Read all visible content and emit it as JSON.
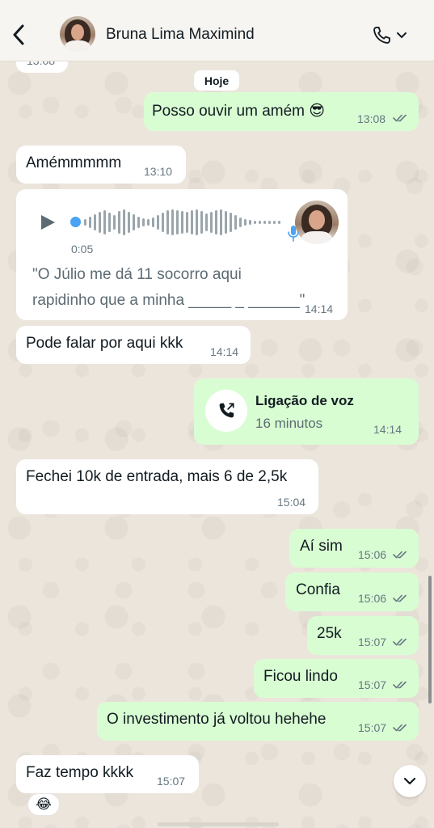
{
  "header": {
    "contact_name": "Bruna Lima Maximind",
    "back_icon": "chevron-left-icon",
    "call_icon": "phone-icon",
    "menu_icon": "chevron-down-icon"
  },
  "partial_top_time": "13:08",
  "day_chip": "Hoje",
  "messages": [
    {
      "dir": "out",
      "text": "Posso ouvir um amém 😎",
      "time": "13:08",
      "read": true
    },
    {
      "dir": "in",
      "text": "Amémmmmm",
      "time": "13:10"
    },
    {
      "dir": "in",
      "type": "voice",
      "duration": "0:05",
      "transcript_line1": "\"O Júlio me dá 11 socorro aqui",
      "transcript_line2": "rapidinho que a minha _____ _ ______\"",
      "time": "14:14"
    },
    {
      "dir": "in",
      "text": "Pode falar por aqui kkk",
      "time": "14:14"
    },
    {
      "dir": "out",
      "type": "call",
      "title": "Ligação de voz",
      "subtitle": "16 minutos",
      "time": "14:14"
    },
    {
      "dir": "in",
      "text": "Fechei 10k de entrada, mais 6 de 2,5k",
      "time": "15:04"
    },
    {
      "dir": "out",
      "text": "Aí sim",
      "time": "15:06",
      "read": true
    },
    {
      "dir": "out",
      "text": "Confia",
      "time": "15:06",
      "read": true
    },
    {
      "dir": "out",
      "text": "25k",
      "time": "15:07",
      "read": true
    },
    {
      "dir": "out",
      "text": "Ficou lindo",
      "time": "15:07",
      "read": true
    },
    {
      "dir": "out",
      "text": "O investimento já voltou hehehe",
      "time": "15:07",
      "read": true
    },
    {
      "dir": "in",
      "text": "Faz tempo kkkk",
      "time": "15:07",
      "reaction": "😂"
    }
  ],
  "colors": {
    "incoming_bubble": "#ffffff",
    "outgoing_bubble": "#d9fdd3",
    "read_ticks": "#667781",
    "voice_dot": "#4aa3f3"
  }
}
